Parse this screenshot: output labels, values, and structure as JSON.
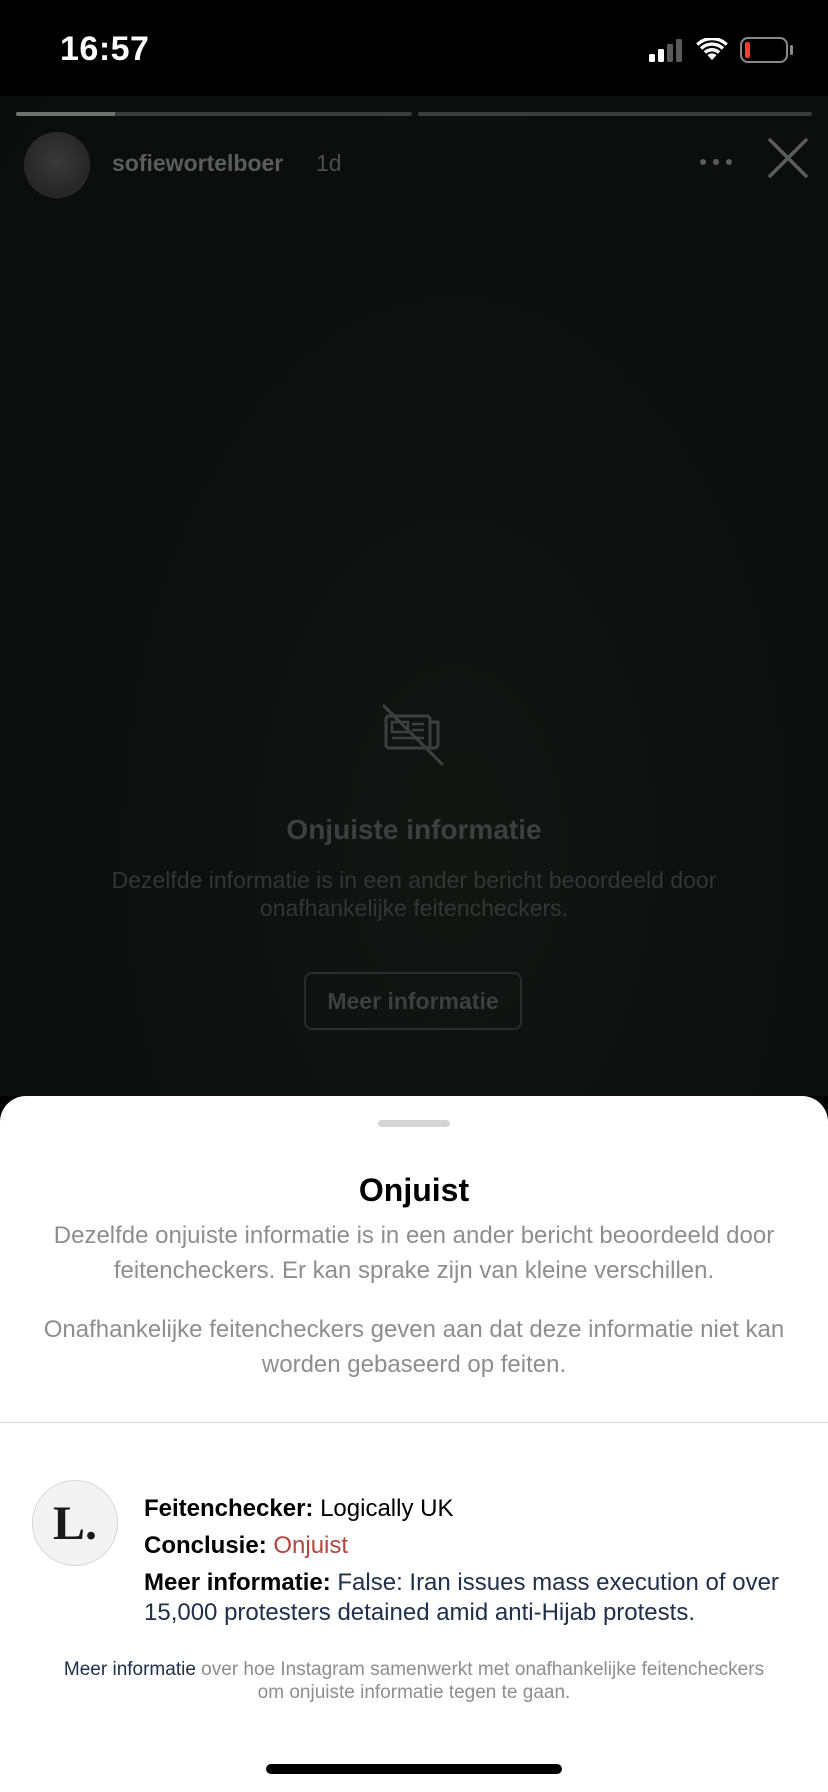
{
  "status_bar": {
    "time": "16:57"
  },
  "story": {
    "progress": [
      0.25,
      0
    ],
    "username": "sofiewortelboer",
    "time_ago": "1d",
    "overlay": {
      "icon": "hidden-news-icon",
      "title": "Onjuiste informatie",
      "description": "Dezelfde informatie is in een ander bericht beoordeeld door onafhankelijke feitencheckers.",
      "button_label": "Meer informatie"
    }
  },
  "sheet": {
    "title": "Onjuist",
    "paragraph1": "Dezelfde onjuiste informatie is in een ander bericht beoordeeld door feitencheckers. Er kan sprake zijn van kleine verschillen.",
    "paragraph2": "Onafhankelijke feitencheckers geven aan dat deze informatie niet kan worden gebaseerd op feiten.",
    "fact_checker": {
      "logo_text": "L.",
      "checker_label": "Feitenchecker:",
      "checker_value": "Logically UK",
      "conclusion_label": "Conclusie:",
      "conclusion_value": "Onjuist",
      "more_label": "Meer informatie:",
      "more_value": "False: Iran issues mass execution of over 15,000 protesters detained amid anti-Hijab protests."
    },
    "footer": {
      "link_text": "Meer informatie",
      "text": " over hoe Instagram samenwerkt met onafhankelijke feitencheckers om onjuiste informatie tegen te gaan."
    }
  },
  "colors": {
    "conclusion_red": "#b0463d",
    "link_navy": "#20304a",
    "muted_gray": "#8e8e8e"
  }
}
